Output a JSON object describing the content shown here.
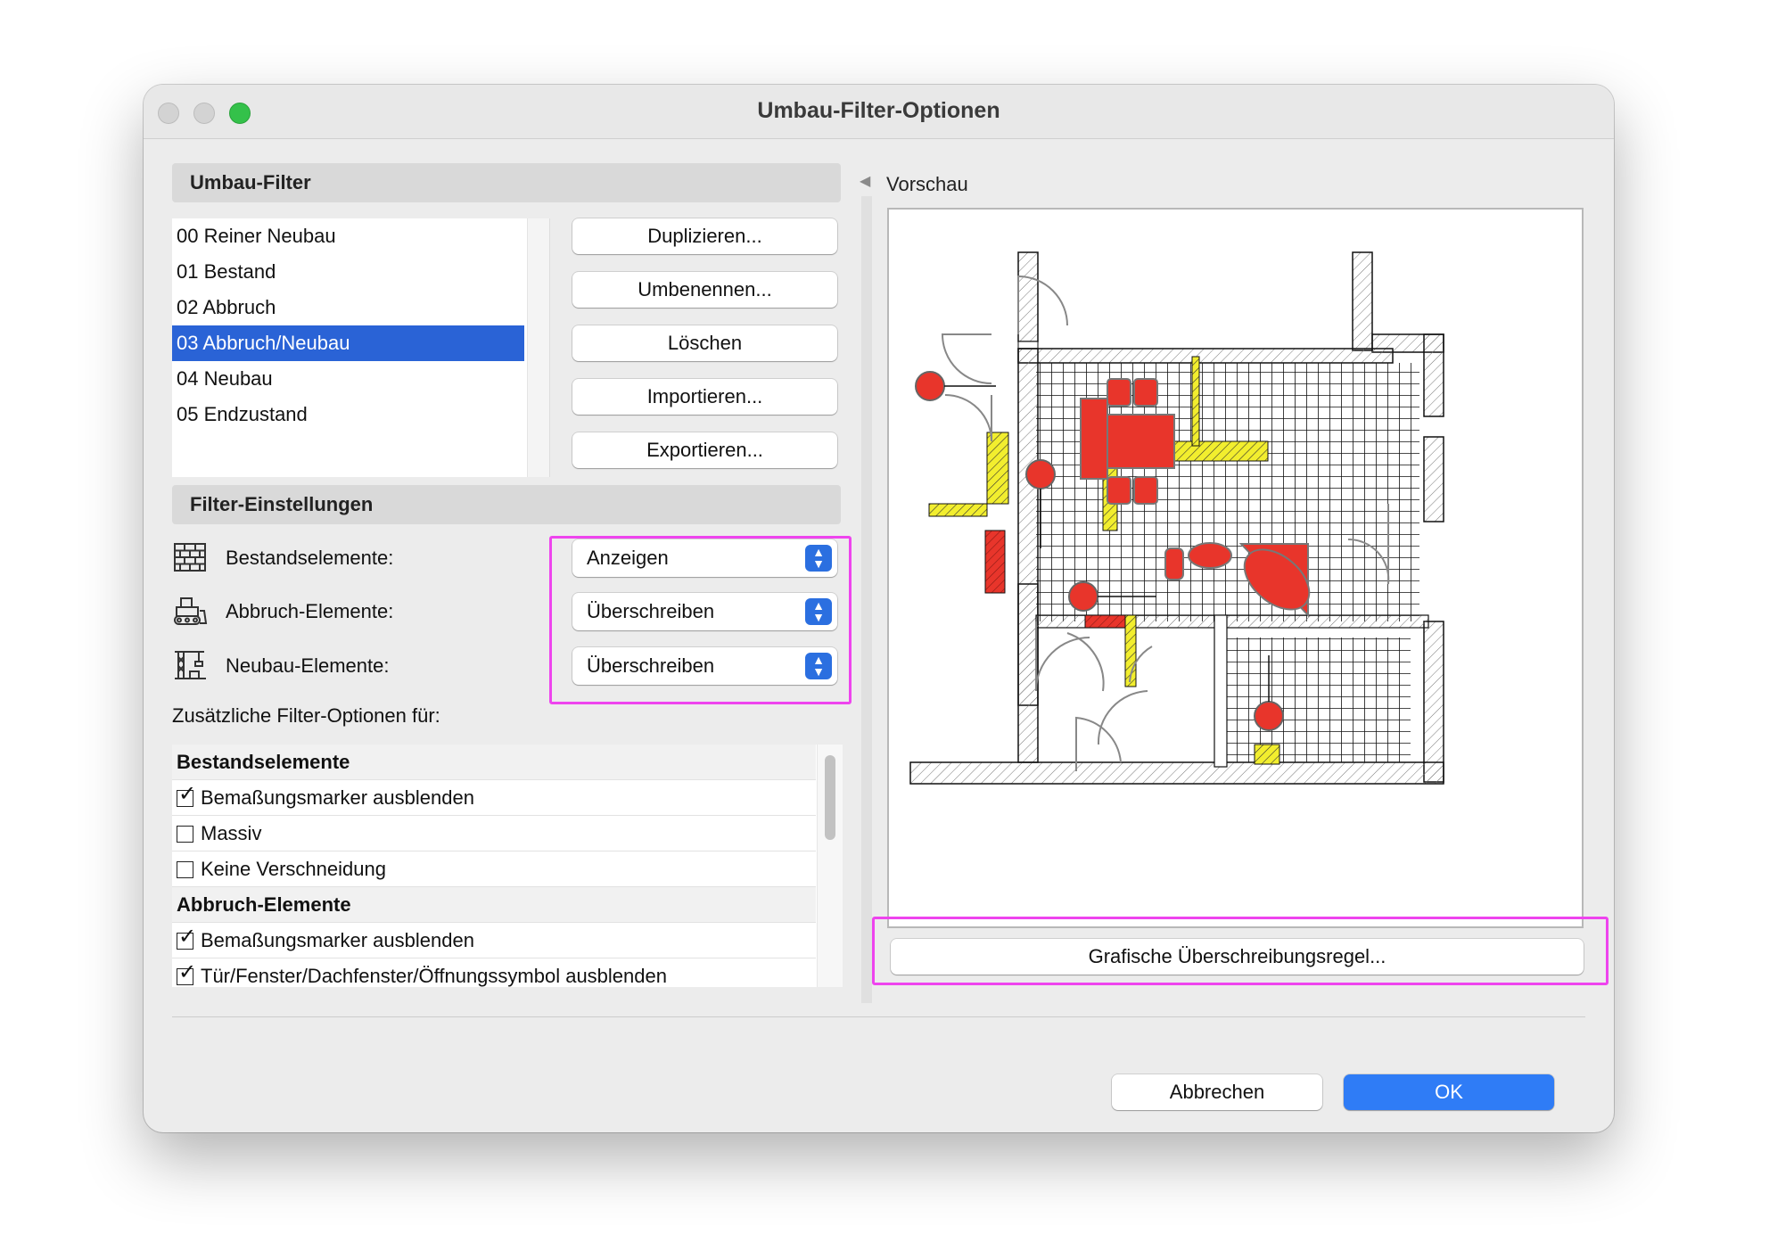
{
  "window": {
    "title": "Umbau-Filter-Optionen"
  },
  "filter_section": {
    "header": "Umbau-Filter",
    "items": [
      "00 Reiner Neubau",
      "01 Bestand",
      "02 Abbruch",
      "03 Abbruch/Neubau",
      "04 Neubau",
      "05 Endzustand"
    ],
    "selected": "03 Abbruch/Neubau",
    "buttons": {
      "duplicate": "Duplizieren...",
      "rename": "Umbenennen...",
      "delete": "Löschen",
      "import": "Importieren...",
      "export": "Exportieren..."
    }
  },
  "settings_section": {
    "header": "Filter-Einstellungen",
    "rows": [
      {
        "label": "Bestandselemente:",
        "value": "Anzeigen",
        "icon": "brick-wall-icon"
      },
      {
        "label": "Abbruch-Elemente:",
        "value": "Überschreiben",
        "icon": "bulldozer-icon"
      },
      {
        "label": "Neubau-Elemente:",
        "value": "Überschreiben",
        "icon": "crane-icon"
      }
    ],
    "additional_label": "Zusätzliche Filter-Optionen für:"
  },
  "options_list": {
    "groups": [
      {
        "header": "Bestandselemente",
        "items": [
          {
            "label": "Bemaßungsmarker ausblenden",
            "checked": true
          },
          {
            "label": "Massiv",
            "checked": false
          },
          {
            "label": "Keine Verschneidung",
            "checked": false
          }
        ]
      },
      {
        "header": "Abbruch-Elemente",
        "items": [
          {
            "label": "Bemaßungsmarker ausblenden",
            "checked": true
          },
          {
            "label": "Tür/Fenster/Dachfenster/Öffnungssymbol ausblenden",
            "checked": true
          }
        ]
      }
    ]
  },
  "preview": {
    "label": "Vorschau",
    "override_button": "Grafische Überschreibungsregel...",
    "colors": {
      "demolition": "#e8352b",
      "new": "#f2ee2e",
      "existing": "#888888"
    }
  },
  "footer": {
    "cancel": "Abbrechen",
    "ok": "OK"
  },
  "colors": {
    "accent": "#2a63d6",
    "ok_button": "#2f7cf6",
    "highlight": "#ee44ee"
  }
}
